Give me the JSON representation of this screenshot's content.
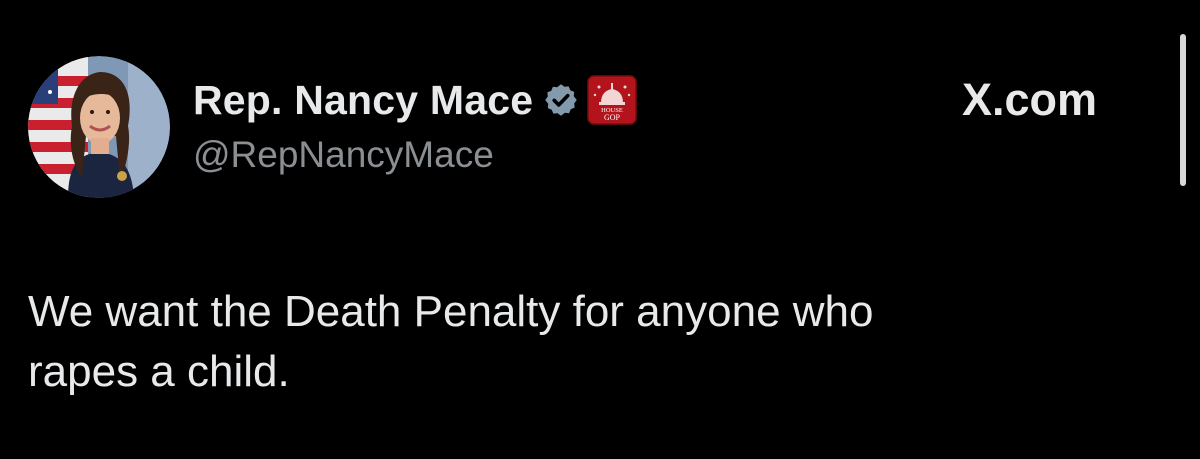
{
  "post": {
    "author": {
      "name": "Rep. Nancy Mace",
      "handle": "@RepNancyMace",
      "verified_color": "#829aab",
      "affiliation_badge": {
        "line1": "HOUSE",
        "line2": "GOP",
        "color": "#b3141b"
      }
    },
    "brand": "X.com",
    "text_lines": [
      "We want the Death Penalty for anyone who",
      "rapes a child."
    ]
  },
  "colors": {
    "background": "#000000",
    "primary_text": "#e7e9ea",
    "secondary_text": "#8b8f94"
  },
  "icons": [
    "avatar",
    "verified-badge-icon",
    "house-gop-badge-icon",
    "scrollbar"
  ]
}
